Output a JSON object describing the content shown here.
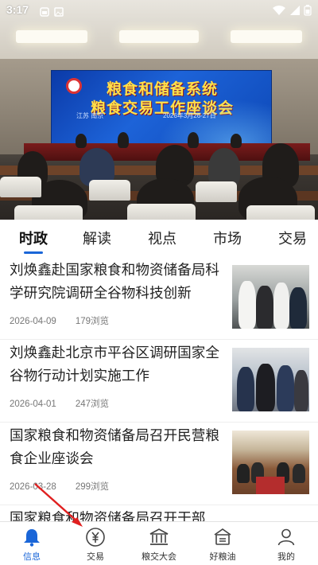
{
  "status_bar": {
    "time": "3:17"
  },
  "hero": {
    "banner_line1": "粮食和储备系统",
    "banner_line2": "粮食交易工作座谈会",
    "banner_place": "江苏 南京",
    "banner_date": "2026年3月26-27日"
  },
  "tabs": [
    {
      "label": "时政",
      "active": true
    },
    {
      "label": "解读"
    },
    {
      "label": "视点"
    },
    {
      "label": "市场"
    },
    {
      "label": "交易"
    }
  ],
  "news": [
    {
      "title": "刘焕鑫赴国家粮食和物资储备局科学研究院调研全谷物科技创新",
      "date": "2026-04-09",
      "views": "179浏览"
    },
    {
      "title": "刘焕鑫赴北京市平谷区调研国家全谷物行动计划实施工作",
      "date": "2026-04-01",
      "views": "247浏览"
    },
    {
      "title": "国家粮食和物资储备局召开民营粮食企业座谈会",
      "date": "2026-03-28",
      "views": "299浏览"
    },
    {
      "title": "国家粮食和物资储备局召开干部"
    }
  ],
  "bottom_nav": [
    {
      "label": "信息",
      "icon": "bell-icon",
      "active": true
    },
    {
      "label": "交易",
      "icon": "yuan-coin-icon"
    },
    {
      "label": "粮交大会",
      "icon": "building-columns-icon"
    },
    {
      "label": "好粮油",
      "icon": "grain-house-icon"
    },
    {
      "label": "我的",
      "icon": "person-icon"
    }
  ],
  "colors": {
    "accent": "#1a66d8",
    "annotation": "#e02020"
  }
}
